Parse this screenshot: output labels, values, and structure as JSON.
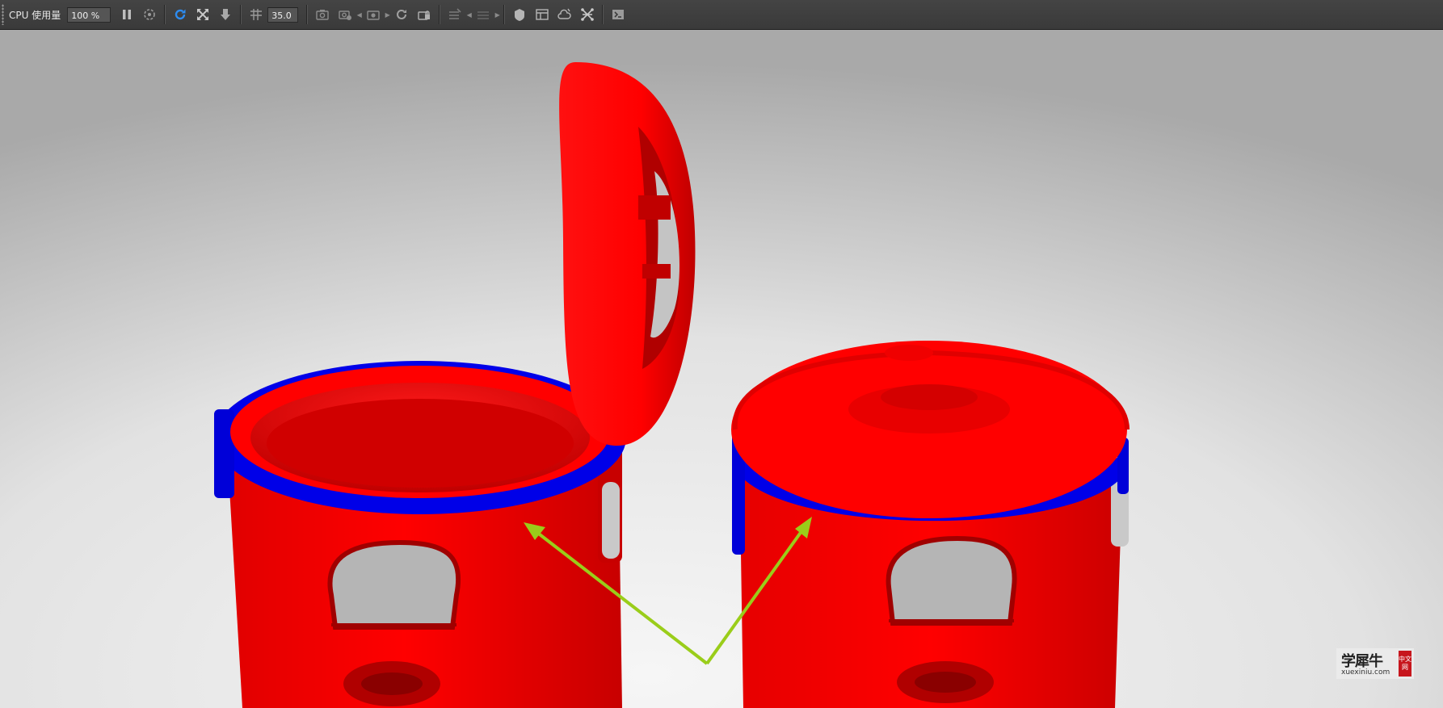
{
  "toolbar": {
    "cpu_label": "CPU 使用量",
    "cpu_value": "100 %",
    "fov_value": "35.0",
    "icons": [
      "pause-icon",
      "region-render-icon",
      "refresh-icon",
      "fit-view-icon",
      "download-icon",
      "camera-grid-icon",
      "screenshot-icon",
      "screenshot-settings-icon",
      "camera-icon",
      "rotate-icon",
      "lock-camera-icon",
      "layers-icon",
      "layers-nav-icon",
      "material-icon",
      "panel-icon",
      "cloud-icon",
      "graph-icon",
      "console-icon"
    ]
  },
  "viewport": {
    "scene": "two red rice cookers on gradient studio background, one with lid open",
    "colors": {
      "body": "#ff0000",
      "rim": "#0000ee",
      "arrow": "#9acd1a",
      "background_top": "#d8d8d8",
      "background_bottom": "#f4f4f4"
    }
  },
  "watermark": {
    "main_text": "学犀牛",
    "url": "xuexiniu.com",
    "badge": "中文网"
  }
}
